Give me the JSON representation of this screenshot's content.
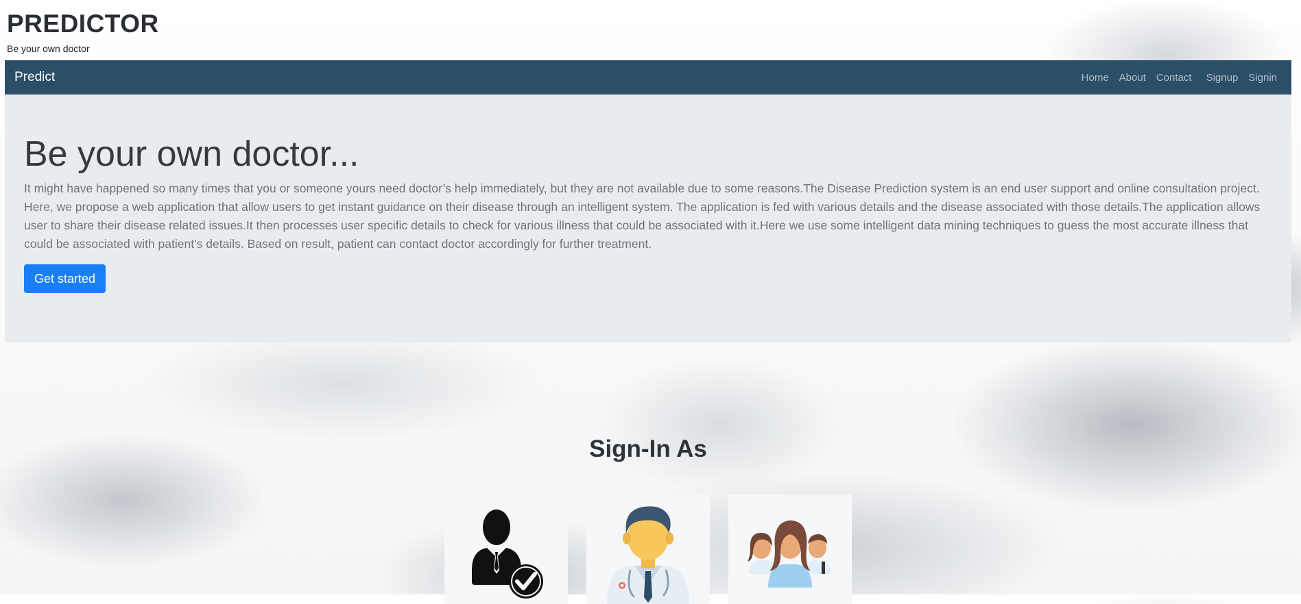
{
  "header": {
    "title": "PREDICTOR",
    "subtitle": "Be your own doctor"
  },
  "navbar": {
    "brand": "Predict",
    "links": [
      "Home",
      "About",
      "Contact",
      "Signup",
      "Signin"
    ],
    "color": "#2b4e69"
  },
  "hero": {
    "title": "Be your own doctor...",
    "description": "It might have happened so many times that you or someone yours need doctor’s help immediately, but they are not available due to some reasons.The Disease Prediction system is an end user support and online consultation project. Here, we propose a web application that allow users to get instant guidance on their disease through an intelligent system. The application is fed with various details and the disease associated with those details.The application allows user to share their disease related issues.It then processes user specific details to check for various illness that could be associated with it.Here we use some intelligent data mining techniques to guess the most accurate illness that could be associated with patient’s details. Based on result, patient can contact doctor accordingly for further treatment.",
    "cta_label": "Get started",
    "cta_color": "#1a7ff6"
  },
  "signin": {
    "title": "Sign-In As",
    "roles": [
      {
        "icon": "verified-user-icon"
      },
      {
        "icon": "doctor-icon"
      },
      {
        "icon": "patients-group-icon"
      }
    ]
  }
}
